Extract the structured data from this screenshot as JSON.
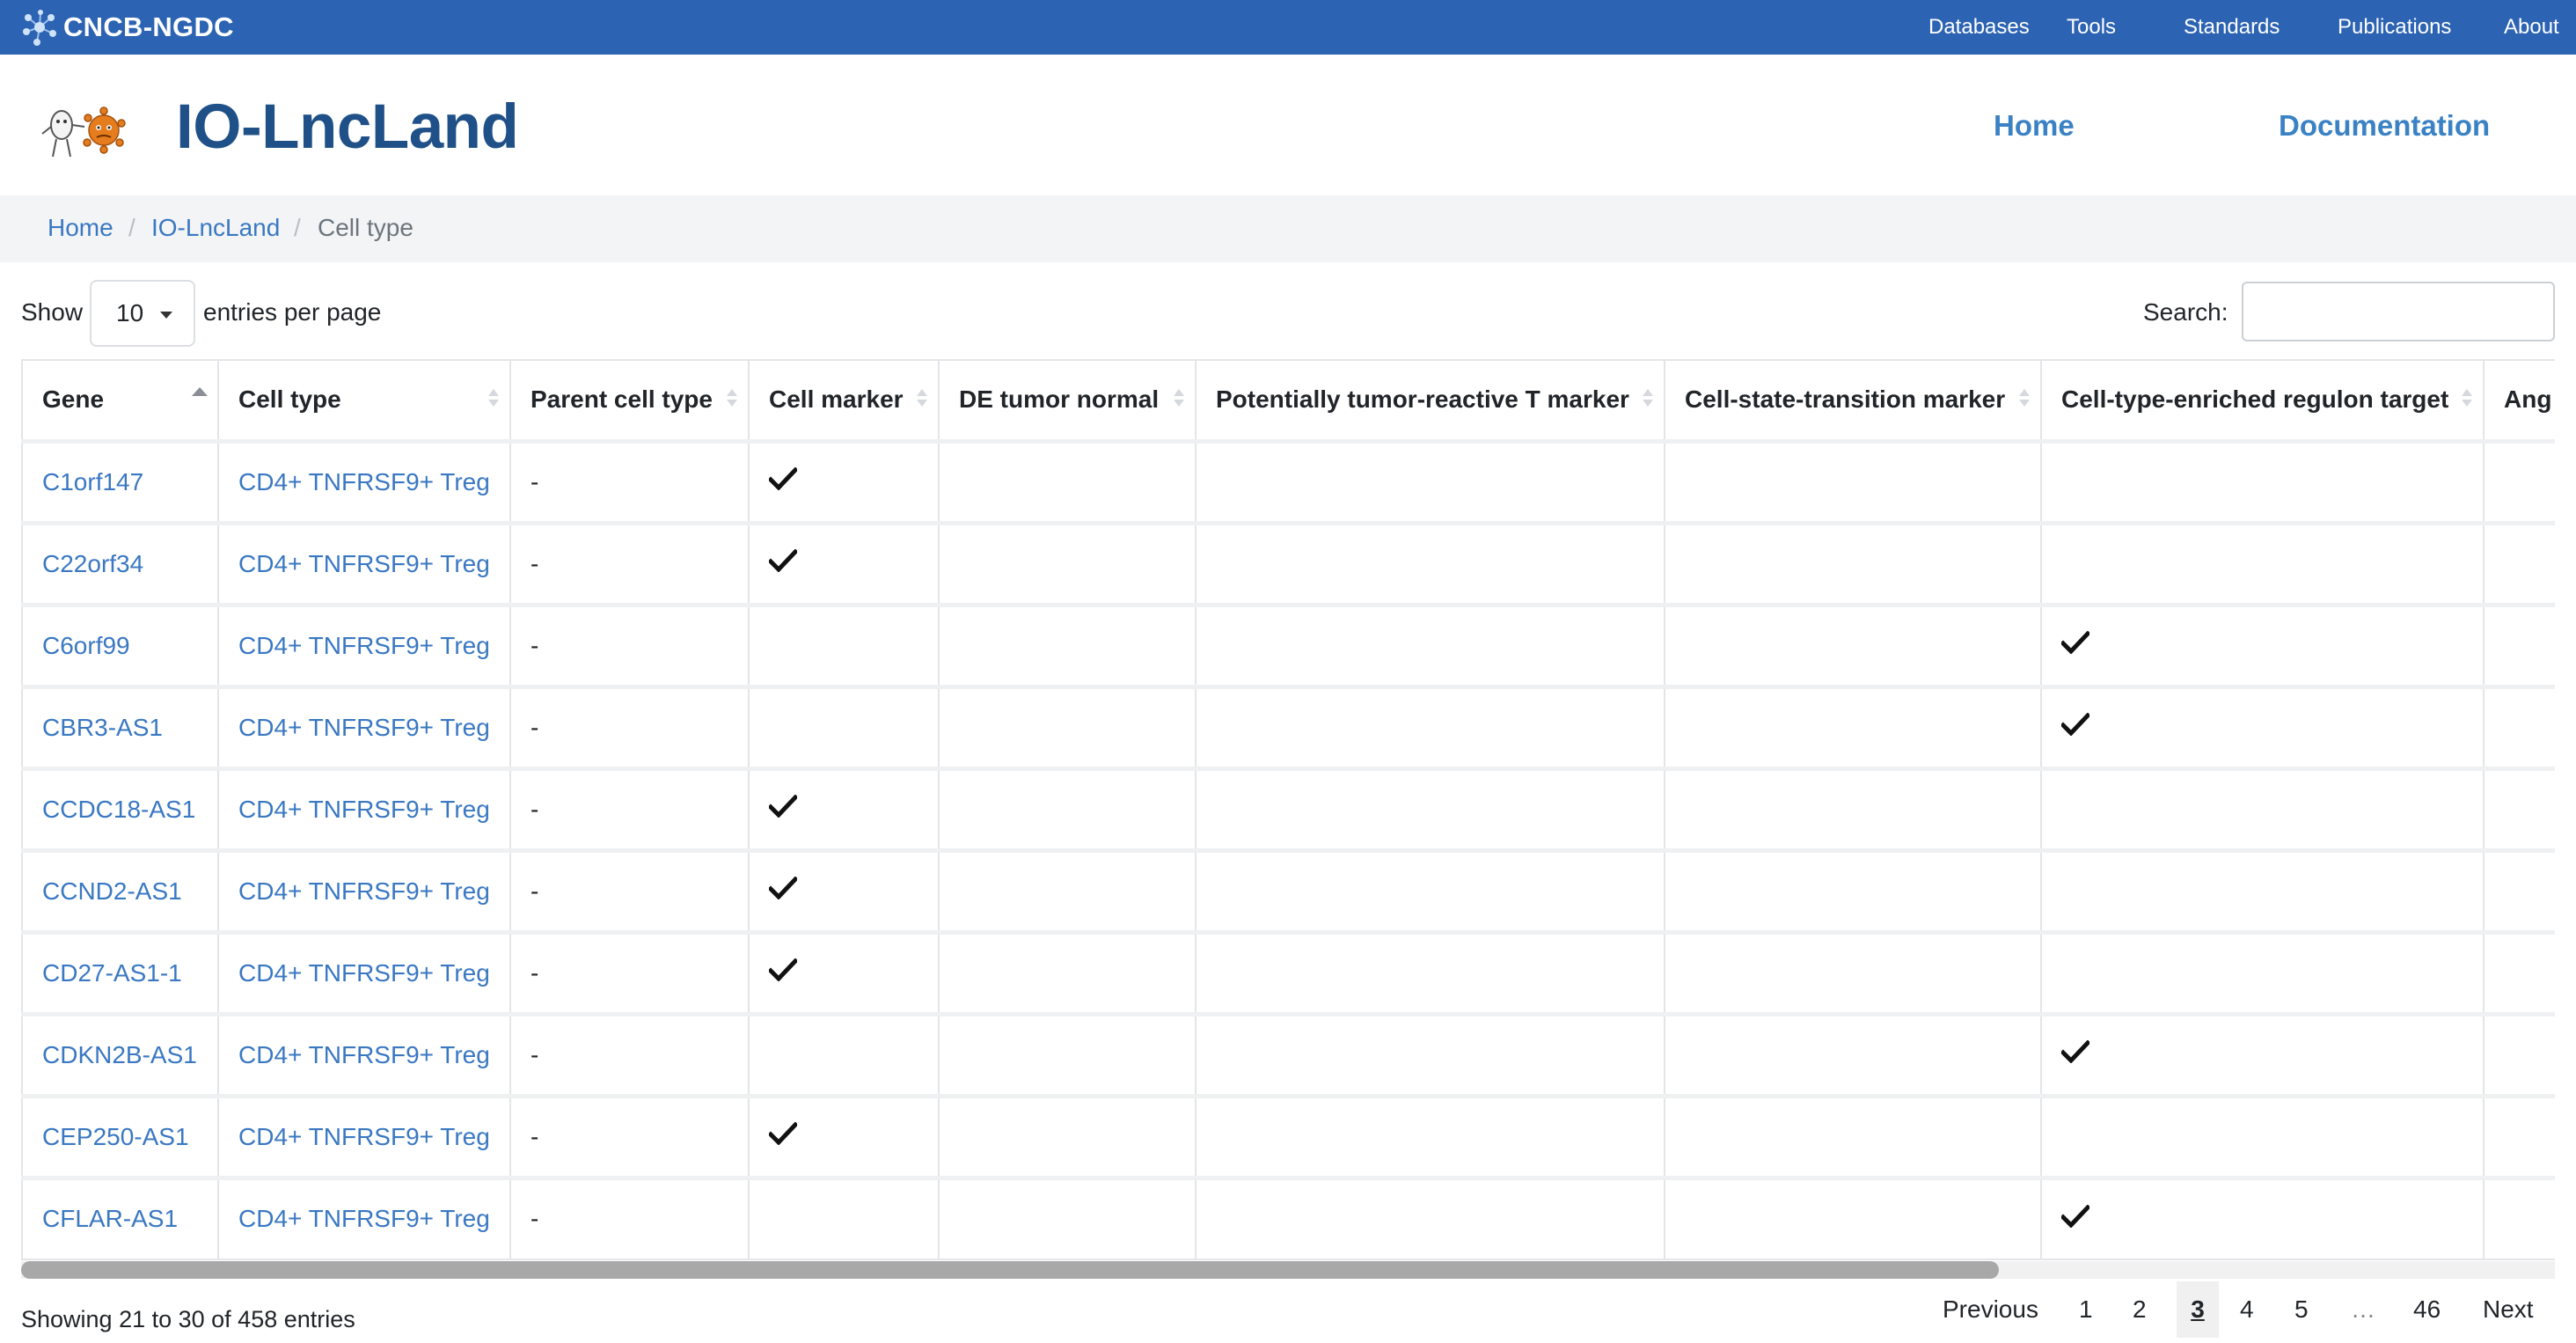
{
  "topbar": {
    "brand": "CNCB-NGDC",
    "nav": [
      "Databases",
      "Tools",
      "Standards",
      "Publications",
      "About"
    ]
  },
  "header": {
    "title": "IO-LncLand",
    "nav": [
      "Home",
      "Documentation"
    ]
  },
  "breadcrumb": {
    "items": [
      "Home",
      "IO-LncLand",
      "Cell type"
    ],
    "separator": "/"
  },
  "controls": {
    "show_label": "Show",
    "page_length": "10",
    "entries_label": "entries per page",
    "search_label": "Search:",
    "search_value": ""
  },
  "table": {
    "columns": [
      "Gene",
      "Cell type",
      "Parent cell type",
      "Cell marker",
      "DE tumor normal",
      "Potentially tumor-reactive T marker",
      "Cell-state-transition marker",
      "Cell-type-enriched regulon target",
      "Ang"
    ],
    "sorted_column": "Gene",
    "sort_direction": "ascending",
    "rows": [
      {
        "gene": "C1orf147",
        "cell_type": "CD4+ TNFRSF9+ Treg",
        "parent": "-",
        "cell_marker": true,
        "regulon_target": false
      },
      {
        "gene": "C22orf34",
        "cell_type": "CD4+ TNFRSF9+ Treg",
        "parent": "-",
        "cell_marker": true,
        "regulon_target": false
      },
      {
        "gene": "C6orf99",
        "cell_type": "CD4+ TNFRSF9+ Treg",
        "parent": "-",
        "cell_marker": false,
        "regulon_target": true
      },
      {
        "gene": "CBR3-AS1",
        "cell_type": "CD4+ TNFRSF9+ Treg",
        "parent": "-",
        "cell_marker": false,
        "regulon_target": true
      },
      {
        "gene": "CCDC18-AS1",
        "cell_type": "CD4+ TNFRSF9+ Treg",
        "parent": "-",
        "cell_marker": true,
        "regulon_target": false
      },
      {
        "gene": "CCND2-AS1",
        "cell_type": "CD4+ TNFRSF9+ Treg",
        "parent": "-",
        "cell_marker": true,
        "regulon_target": false
      },
      {
        "gene": "CD27-AS1-1",
        "cell_type": "CD4+ TNFRSF9+ Treg",
        "parent": "-",
        "cell_marker": true,
        "regulon_target": false
      },
      {
        "gene": "CDKN2B-AS1",
        "cell_type": "CD4+ TNFRSF9+ Treg",
        "parent": "-",
        "cell_marker": false,
        "regulon_target": true
      },
      {
        "gene": "CEP250-AS1",
        "cell_type": "CD4+ TNFRSF9+ Treg",
        "parent": "-",
        "cell_marker": true,
        "regulon_target": false
      },
      {
        "gene": "CFLAR-AS1",
        "cell_type": "CD4+ TNFRSF9+ Treg",
        "parent": "-",
        "cell_marker": false,
        "regulon_target": true
      }
    ]
  },
  "footer": {
    "info": "Showing 21 to 30 of 458 entries",
    "pagination": {
      "previous": "Previous",
      "pages": [
        "1",
        "2",
        "3",
        "4",
        "5"
      ],
      "current": "3",
      "ellipsis": "…",
      "last": "46",
      "next": "Next"
    }
  },
  "colors": {
    "topbar": "#2c63b3",
    "title": "#1f5188",
    "link": "#3a78c2",
    "breadcrumb_bg": "#f3f4f5"
  }
}
